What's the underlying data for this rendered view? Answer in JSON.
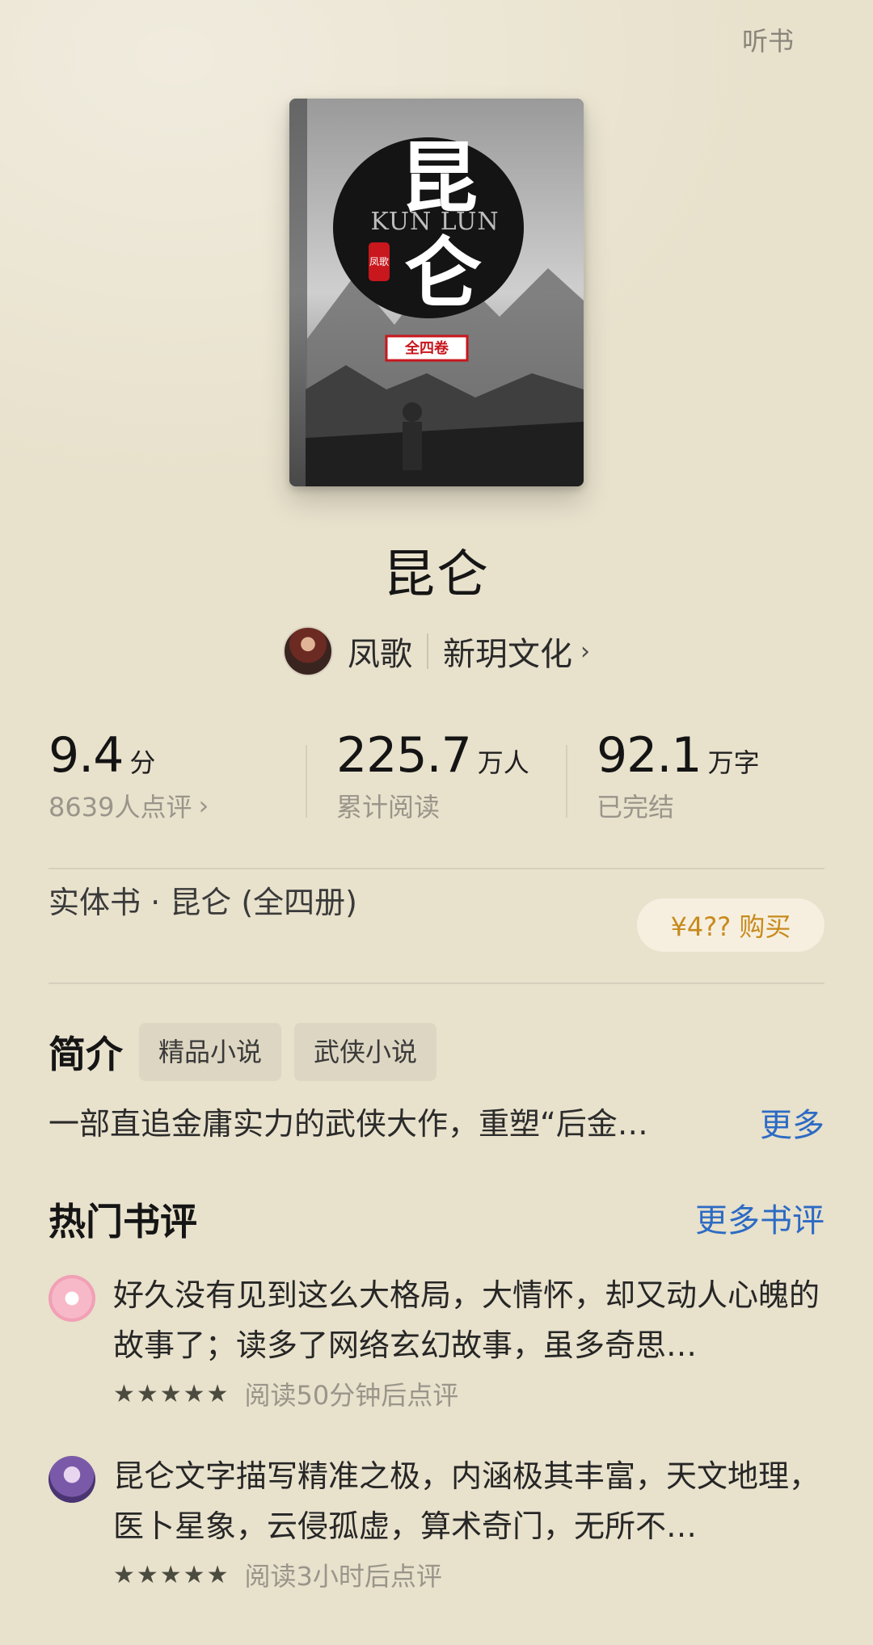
{
  "header": {
    "listen_label": "听书"
  },
  "book": {
    "cover": {
      "big_char_1": "昆",
      "big_char_2": "仑",
      "latin": "KUN LUN",
      "seal": "凤歌",
      "volume_badge": "全四卷"
    },
    "title": "昆仑",
    "author": "凤歌",
    "publisher": "新玥文化",
    "chevron": "›"
  },
  "stats": {
    "rating": {
      "value": "9.4",
      "unit": "分",
      "sub": "8639人点评",
      "chev": "›"
    },
    "readers": {
      "value": "225.7",
      "unit": "万人",
      "sub": "累计阅读"
    },
    "words": {
      "value": "92.1",
      "unit": "万字",
      "sub": "已完结"
    }
  },
  "physical": {
    "label": "实体书 · 昆仑 (全四册)",
    "buy_label": "¥4?? 购买"
  },
  "intro": {
    "heading": "简介",
    "tags": [
      "精品小说",
      "武侠小说"
    ],
    "text": "一部直追金庸实力的武侠大作，重塑“后金…",
    "more": "更多"
  },
  "reviews": {
    "heading": "热门书评",
    "more": "更多书评",
    "items": [
      {
        "text": "好久没有见到这么大格局，大情怀，却又动人心魄的故事了；读多了网络玄幻故事，虽多奇思…",
        "stars": "★★★★★",
        "meta": "阅读50分钟后点评"
      },
      {
        "text": "昆仑文字描写精准之极，内涵极其丰富，天文地理，医卜星象，云侵孤虚，算术奇门，无所不…",
        "stars": "★★★★★",
        "meta": "阅读3小时后点评"
      }
    ]
  },
  "colors": {
    "background": "#e8e1cc",
    "link": "#2c6bc4",
    "buy_text": "#c88a1c",
    "buy_bg": "#f6efdf"
  }
}
